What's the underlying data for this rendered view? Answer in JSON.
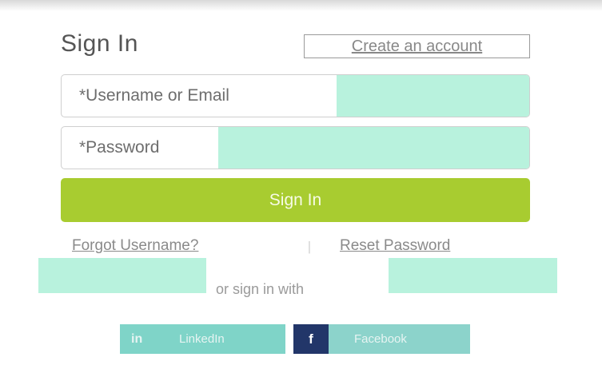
{
  "form": {
    "title": "Sign In",
    "create_account_link": "Create an account",
    "username_placeholder": "*Username or Email",
    "password_placeholder": "*Password",
    "submit_label": "Sign In",
    "forgot_username_link": "Forgot Username?",
    "separator": "|",
    "reset_password_link": "Reset Password",
    "social_divider_text": "or sign in with"
  },
  "social": {
    "linkedin": {
      "icon_text": "in",
      "label": "LinkedIn"
    },
    "facebook": {
      "icon_text": "f",
      "label": "Facebook"
    }
  },
  "colors": {
    "accent_green": "#a8cc30",
    "highlight_mint": "#b8f2dd",
    "linkedin_teal": "#7fd4c8",
    "facebook_navy": "#223669"
  }
}
